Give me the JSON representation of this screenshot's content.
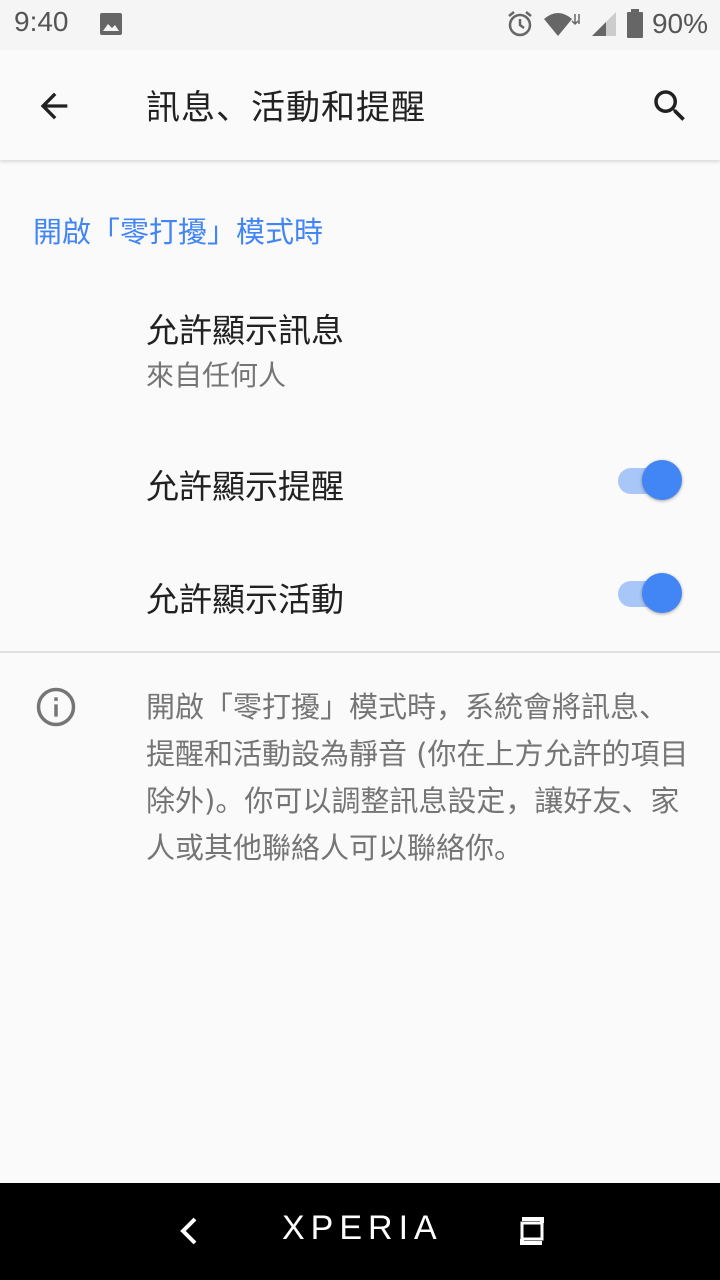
{
  "status_bar": {
    "time": "9:40",
    "battery": "90%",
    "icons": [
      "image-icon",
      "alarm-icon",
      "wifi-icon",
      "signal-icon",
      "battery-icon"
    ]
  },
  "app_bar": {
    "title": "訊息、活動和提醒",
    "back_icon": "arrow-back-icon",
    "search_icon": "search-icon"
  },
  "section": {
    "header": "開啟「零打擾」模式時"
  },
  "preferences": [
    {
      "title": "允許顯示訊息",
      "summary": "來自任何人"
    },
    {
      "title": "允許顯示提醒",
      "toggle": true
    },
    {
      "title": "允許顯示活動",
      "toggle": true
    }
  ],
  "info": {
    "icon": "info-icon",
    "text": "開啟「零打擾」模式時，系統會將訊息、提醒和活動設為靜音 (你在上方允許的項目除外)。你可以調整訊息設定，讓好友、家人或其他聯絡人可以聯絡你。"
  },
  "nav_bar": {
    "brand": "XPERIA"
  },
  "colors": {
    "accent": "#4285f4",
    "toggle_track": "#a8c6f7",
    "text_primary": "#212121",
    "text_secondary": "#757575",
    "background": "#fafafa"
  }
}
